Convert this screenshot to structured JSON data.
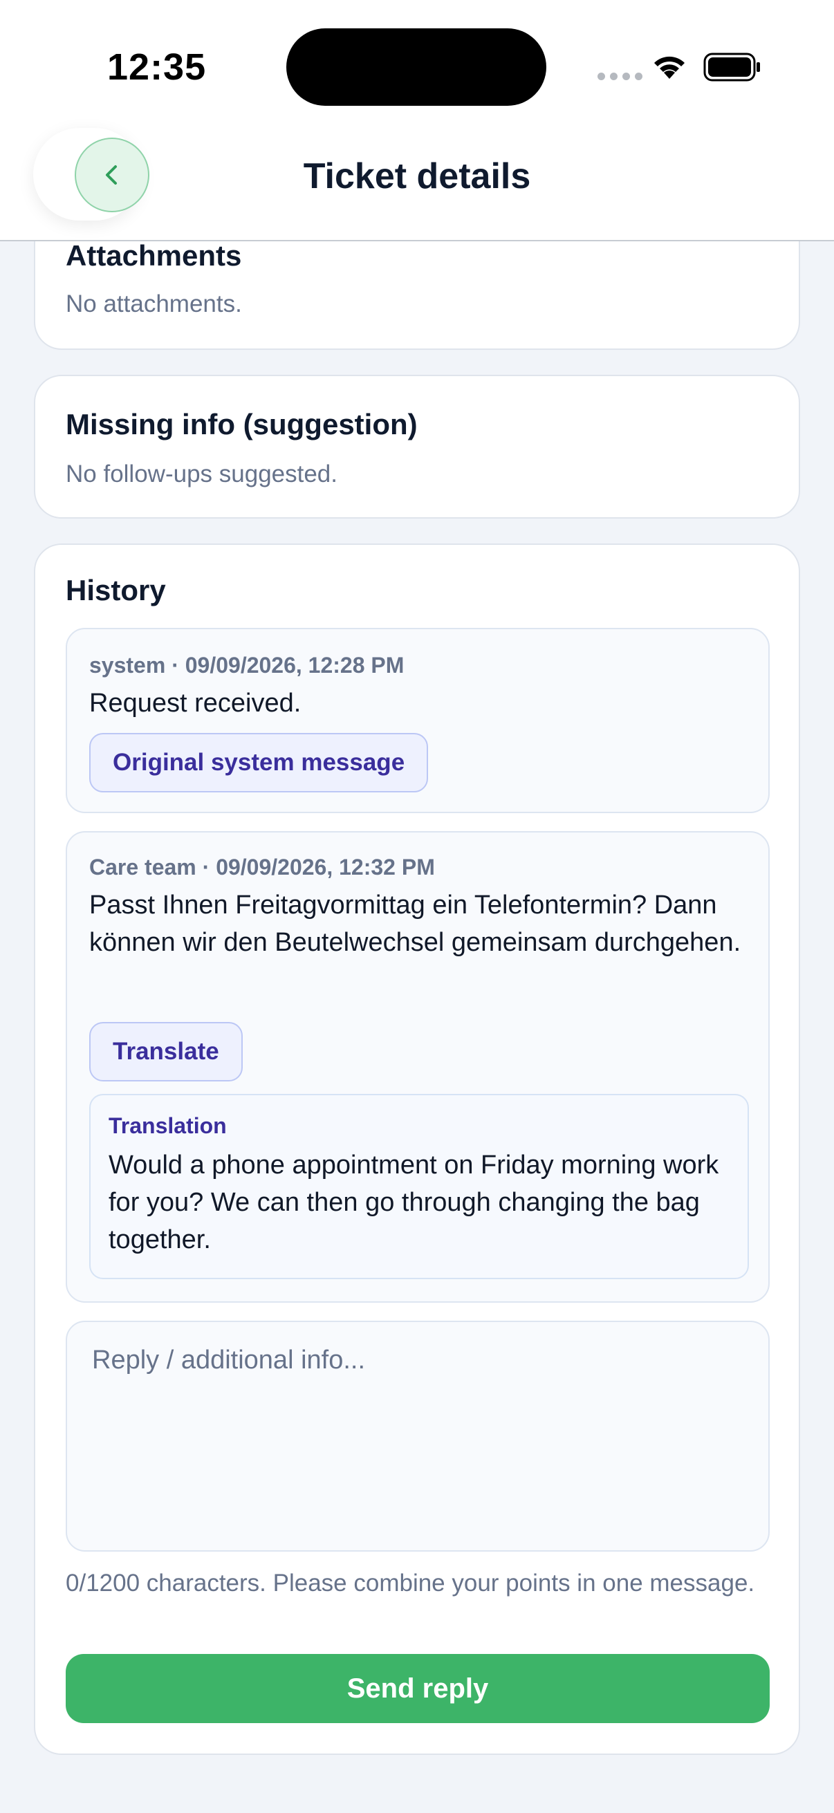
{
  "status_bar": {
    "time": "12:35"
  },
  "header": {
    "title": "Ticket details",
    "back_icon": "chevron-left-icon"
  },
  "attachments": {
    "title": "Attachments",
    "empty_text": "No attachments."
  },
  "missing_info": {
    "title": "Missing info (suggestion)",
    "empty_text": "No follow-ups suggested."
  },
  "history": {
    "title": "History",
    "messages": [
      {
        "meta": "system · 09/09/2026, 12:28 PM",
        "text": "Request received.",
        "button_label": "Original system message"
      },
      {
        "meta": "Care team · 09/09/2026, 12:32 PM",
        "text": "Passt Ihnen Freitagvormittag ein Telefontermin? Dann können wir den Beutelwechsel gemeinsam durchgehen.",
        "button_label": "Translate",
        "translation_label": "Translation",
        "translation_text": "Would a phone appointment on Friday morning work for you? We can then go through changing the bag together."
      }
    ]
  },
  "reply": {
    "placeholder": "Reply / additional info...",
    "value": "",
    "char_info": "0/1200 characters. Please combine your points in one message.",
    "send_label": "Send reply"
  },
  "colors": {
    "accent_green": "#3db468",
    "link_purple": "#3a2e9c",
    "background": "#f1f4f9"
  }
}
